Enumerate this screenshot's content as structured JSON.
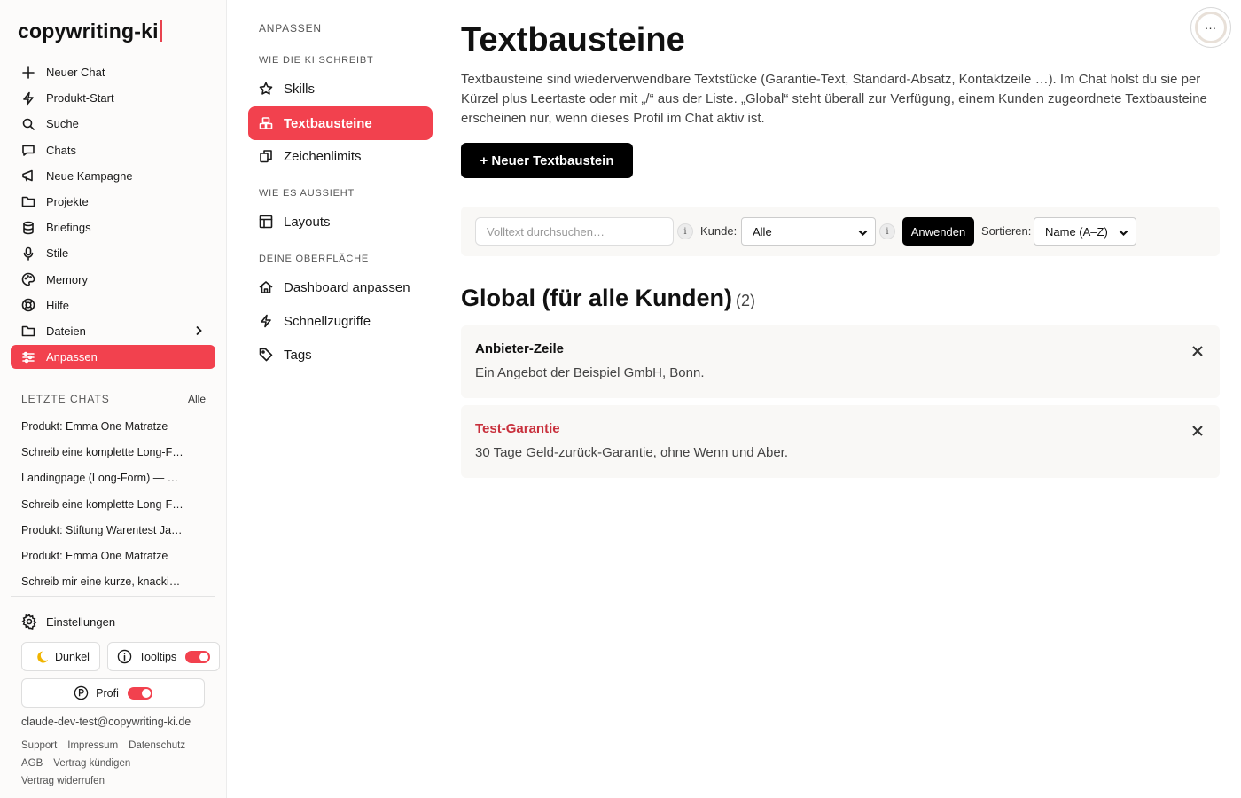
{
  "app": {
    "logo": "copywriting-ki"
  },
  "sidebar": {
    "items": [
      {
        "label": "Neuer Chat",
        "icon": "plus-icon"
      },
      {
        "label": "Produkt-Start",
        "icon": "lightning-icon"
      },
      {
        "label": "Suche",
        "icon": "search-icon"
      },
      {
        "label": "Chats",
        "icon": "chat-bubble-icon"
      },
      {
        "label": "Neue Kampagne",
        "icon": "megaphone-icon"
      },
      {
        "label": "Projekte",
        "icon": "folder-icon"
      },
      {
        "label": "Briefings",
        "icon": "database-icon"
      },
      {
        "label": "Stile",
        "icon": "microphone-icon"
      },
      {
        "label": "Memory",
        "icon": "palette-icon"
      },
      {
        "label": "Hilfe",
        "icon": "lifebuoy-icon"
      },
      {
        "label": "Dateien",
        "icon": "folder-icon"
      },
      {
        "label": "Anpassen",
        "icon": "sliders-icon",
        "active": true
      }
    ],
    "recent_label": "LETZTE CHATS",
    "recent_all": "Alle",
    "recent_chats": [
      "Produkt: Emma One Matratze",
      "Schreib eine komplette Long-F…",
      "Landingpage (Long-Form) — …",
      "Schreib eine komplette Long-F…",
      "Produkt: Stiftung Warentest Ja…",
      "Produkt: Emma One Matratze",
      "Schreib mir eine kurze, knacki…"
    ],
    "settings_label": "Einstellungen",
    "dark_label": "Dunkel",
    "tooltips_label": "Tooltips",
    "tooltips_on": true,
    "profi_label": "Profi",
    "profi_on": true,
    "email": "claude-dev-test@copywriting-ki.de",
    "footer_links": [
      "Support",
      "Impressum",
      "Datenschutz",
      "AGB",
      "Vertrag kündigen",
      "Vertrag widerrufen"
    ]
  },
  "subnav": {
    "heading": "ANPASSEN",
    "section_1": "WIE DIE KI SCHREIBT",
    "skills": "Skills",
    "textbausteine": "Textbausteine",
    "zeichenlimits": "Zeichenlimits",
    "section_2": "WIE ES AUSSIEHT",
    "layouts": "Layouts",
    "section_3": "DEINE OBERFLÄCHE",
    "dashboard": "Dashboard anpassen",
    "schnellzugriffe": "Schnellzugriffe",
    "tags": "Tags"
  },
  "main": {
    "title": "Textbausteine",
    "description": "Textbausteine sind wiederverwendbare Textstücke (Garantie-Text, Standard-Absatz, Kontaktzeile …). Im Chat holst du sie per Kürzel plus Leertaste oder mit „/“ aus der Liste. „Global“ steht überall zur Verfügung, einem Kunden zugeordnete Textbausteine erscheinen nur, wenn dieses Profil im Chat aktiv ist.",
    "new_button": "+ Neuer Textbaustein",
    "filter": {
      "search_placeholder": "Volltext durchsuchen…",
      "info": "i",
      "kunde_label": "Kunde:",
      "kunde_value": "Alle",
      "apply": "Anwenden",
      "sort_label": "Sortieren:",
      "sort_value": "Name (A–Z)"
    },
    "section_title": "Global (für alle Kunden)",
    "section_count": "(2)",
    "cards": [
      {
        "name": "Anbieter-Zeile",
        "text": "Ein Angebot der Beispiel GmbH, Bonn."
      },
      {
        "name": "Test-Garantie",
        "text": "30 Tage Geld-zurück-Garantie, ohne Wenn und Aber."
      }
    ],
    "more_button": "…"
  },
  "colors": {
    "accent": "#f2414e",
    "accent_text": "#c8303c",
    "panel": "#f9f8f6"
  }
}
